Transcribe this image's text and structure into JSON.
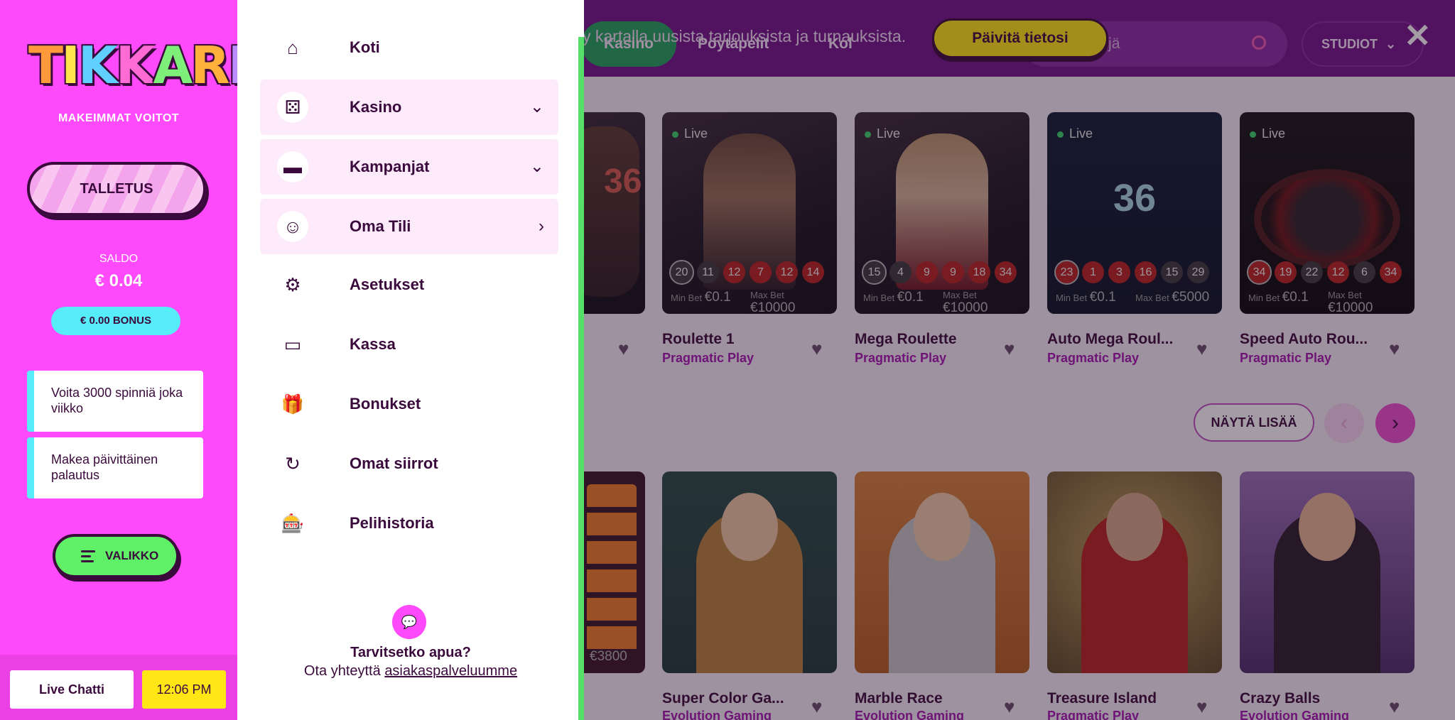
{
  "background": {
    "tabs": [
      {
        "label": "Kasino",
        "active": true
      },
      {
        "label": "Pöytäpelit",
        "active": false
      },
      {
        "label": "Kol",
        "active": false
      }
    ],
    "search_placeholder": "Hae pelejä",
    "studio_label": "STUDIOT",
    "notice_text": "y kartalla uusista tarjouksista ja turnauksista.",
    "update_button": "Päivitä tietosi",
    "close_symbol": "✕",
    "show_more": "NÄYTÄ LISÄÄ",
    "prev_symbol": "‹",
    "next_symbol": "›",
    "live_label": "Live",
    "min_bet_label": "Min Bet",
    "max_bet_label": "Max Bet",
    "partial_card_number": "36",
    "partial_card_bet": "€3800",
    "live_games": [
      {
        "title": "Roulette 1",
        "provider": "Pragmatic Play",
        "results": [
          "20",
          "11",
          "12",
          "7",
          "12",
          "14"
        ],
        "colors": [
          "black",
          "black",
          "red",
          "red",
          "red",
          "red"
        ],
        "min_bet": "€0.1",
        "max_bet": "€10000"
      },
      {
        "title": "Mega Roulette",
        "provider": "Pragmatic Play",
        "results": [
          "15",
          "4",
          "9",
          "9",
          "18",
          "34"
        ],
        "colors": [
          "black",
          "black",
          "red",
          "red",
          "red",
          "red"
        ],
        "min_bet": "€0.1",
        "max_bet": "€10000"
      },
      {
        "title": "Auto Mega Roul...",
        "provider": "Pragmatic Play",
        "results": [
          "23",
          "1",
          "3",
          "16",
          "15",
          "29"
        ],
        "colors": [
          "red",
          "red",
          "red",
          "red",
          "black",
          "black"
        ],
        "min_bet": "€0.1",
        "max_bet": "€5000",
        "big_number": "36"
      },
      {
        "title": "Speed Auto Rou...",
        "provider": "Pragmatic Play",
        "results": [
          "34",
          "19",
          "22",
          "12",
          "6",
          "34"
        ],
        "colors": [
          "red",
          "red",
          "black",
          "red",
          "black",
          "red"
        ],
        "min_bet": "€0.1",
        "max_bet": "€10000"
      }
    ],
    "show_games": [
      {
        "title": "Super Color Ga...",
        "provider": "Evolution Gaming"
      },
      {
        "title": "Marble Race",
        "provider": "Evolution Gaming"
      },
      {
        "title": "Treasure Island",
        "provider": "Pragmatic Play"
      },
      {
        "title": "Crazy Balls",
        "provider": "Evolution Gaming"
      }
    ]
  },
  "sidebar": {
    "logo_letters": [
      "T",
      "I",
      "K",
      "K",
      "A",
      "R",
      "I"
    ],
    "logo_colors": [
      "#ff9a3c",
      "#ffe44d",
      "#5fd0ff",
      "#ff6bd5",
      "#7ef07a",
      "#ffb13c",
      "#b98cff"
    ],
    "tagline": "MAKEIMMAT VOITOT",
    "deposit_button": "TALLETUS",
    "saldo_label": "SALDO",
    "saldo_value": "€ 0.04",
    "bonus_pill": "€ 0.00 BONUS",
    "promos": [
      {
        "text": "Voita 3000 spinniä joka viikko"
      },
      {
        "text": "Makea päivittäinen palautus"
      }
    ],
    "menu_button": "VALIKKO",
    "live_chat": "Live Chatti",
    "time": "12:06 PM"
  },
  "drawer": {
    "items": [
      {
        "label": "Koti",
        "icon": "home-icon",
        "glyph": "⌂",
        "expandable": false,
        "arrow": ""
      },
      {
        "label": "Kasino",
        "icon": "dice-icon",
        "glyph": "⚄",
        "expandable": true,
        "arrow": "⌄"
      },
      {
        "label": "Kampanjat",
        "icon": "ticket-icon",
        "glyph": "▬",
        "expandable": true,
        "arrow": "⌄"
      },
      {
        "label": "Oma Tili",
        "icon": "account-icon",
        "glyph": "☺",
        "expandable": true,
        "arrow": "›"
      },
      {
        "label": "Asetukset",
        "icon": "gear-icon",
        "glyph": "⚙",
        "expandable": false,
        "arrow": ""
      },
      {
        "label": "Kassa",
        "icon": "card-icon",
        "glyph": "▭",
        "expandable": false,
        "arrow": ""
      },
      {
        "label": "Bonukset",
        "icon": "gift-icon",
        "glyph": "🎁",
        "expandable": false,
        "arrow": ""
      },
      {
        "label": "Omat siirrot",
        "icon": "transactions-icon",
        "glyph": "↻",
        "expandable": false,
        "arrow": ""
      },
      {
        "label": "Pelihistoria",
        "icon": "history-icon",
        "glyph": "🎰",
        "expandable": false,
        "arrow": ""
      }
    ],
    "help_icon": "💬",
    "help_title": "Tarvitsetko apua?",
    "help_prefix": "Ota yhteyttä",
    "help_link": "asiakaspalveluumme"
  }
}
